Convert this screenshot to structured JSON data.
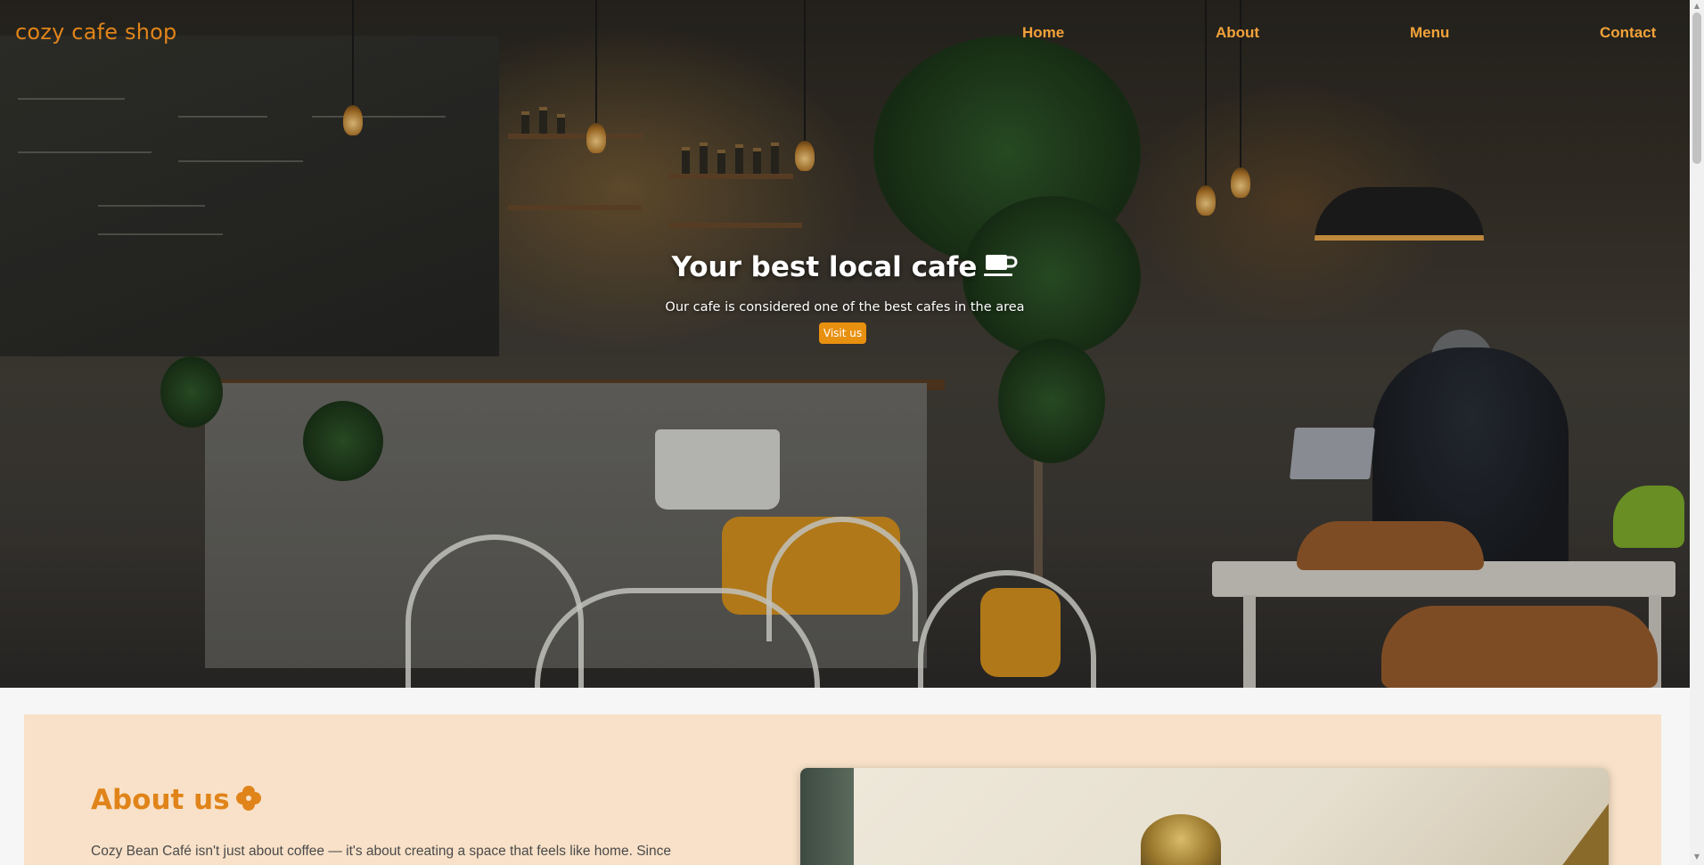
{
  "nav": {
    "brand": "cozy cafe shop",
    "links": [
      {
        "label": "Home"
      },
      {
        "label": "About"
      },
      {
        "label": "Menu"
      },
      {
        "label": "Contact"
      }
    ]
  },
  "hero": {
    "title": "Your best local cafe",
    "title_icon": "coffee-cup-icon",
    "subtitle": "Our cafe is considered one of the best cafes in the area",
    "cta_label": "Visit us",
    "background_image": "cafe-interior-photo"
  },
  "about": {
    "title": "About us",
    "title_icon": "clover-icon",
    "text": "Cozy Bean Café isn't just about coffee — it's about creating a space that feels like home. Since",
    "image": "cafe-ceiling-photo"
  },
  "colors": {
    "accent": "#e0841a",
    "nav_link": "#f3a23a",
    "button": "#e8900f",
    "about_bg": "#f8e1c8",
    "page_bg": "#f6f6f6"
  }
}
